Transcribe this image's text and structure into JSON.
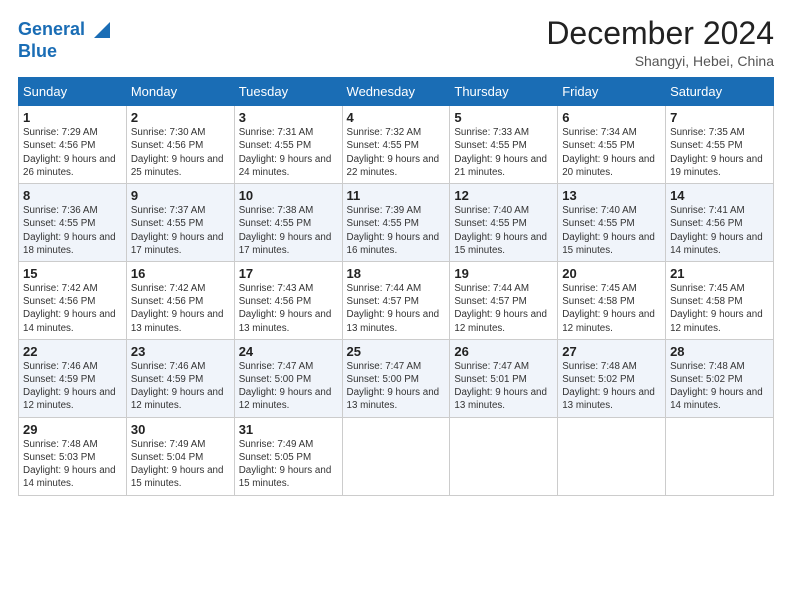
{
  "header": {
    "logo_line1": "General",
    "logo_line2": "Blue",
    "month_title": "December 2024",
    "location": "Shangyi, Hebei, China"
  },
  "weekdays": [
    "Sunday",
    "Monday",
    "Tuesday",
    "Wednesday",
    "Thursday",
    "Friday",
    "Saturday"
  ],
  "weeks": [
    [
      {
        "day": "1",
        "info": "Sunrise: 7:29 AM\nSunset: 4:56 PM\nDaylight: 9 hours and 26 minutes."
      },
      {
        "day": "2",
        "info": "Sunrise: 7:30 AM\nSunset: 4:56 PM\nDaylight: 9 hours and 25 minutes."
      },
      {
        "day": "3",
        "info": "Sunrise: 7:31 AM\nSunset: 4:55 PM\nDaylight: 9 hours and 24 minutes."
      },
      {
        "day": "4",
        "info": "Sunrise: 7:32 AM\nSunset: 4:55 PM\nDaylight: 9 hours and 22 minutes."
      },
      {
        "day": "5",
        "info": "Sunrise: 7:33 AM\nSunset: 4:55 PM\nDaylight: 9 hours and 21 minutes."
      },
      {
        "day": "6",
        "info": "Sunrise: 7:34 AM\nSunset: 4:55 PM\nDaylight: 9 hours and 20 minutes."
      },
      {
        "day": "7",
        "info": "Sunrise: 7:35 AM\nSunset: 4:55 PM\nDaylight: 9 hours and 19 minutes."
      }
    ],
    [
      {
        "day": "8",
        "info": "Sunrise: 7:36 AM\nSunset: 4:55 PM\nDaylight: 9 hours and 18 minutes."
      },
      {
        "day": "9",
        "info": "Sunrise: 7:37 AM\nSunset: 4:55 PM\nDaylight: 9 hours and 17 minutes."
      },
      {
        "day": "10",
        "info": "Sunrise: 7:38 AM\nSunset: 4:55 PM\nDaylight: 9 hours and 17 minutes."
      },
      {
        "day": "11",
        "info": "Sunrise: 7:39 AM\nSunset: 4:55 PM\nDaylight: 9 hours and 16 minutes."
      },
      {
        "day": "12",
        "info": "Sunrise: 7:40 AM\nSunset: 4:55 PM\nDaylight: 9 hours and 15 minutes."
      },
      {
        "day": "13",
        "info": "Sunrise: 7:40 AM\nSunset: 4:55 PM\nDaylight: 9 hours and 15 minutes."
      },
      {
        "day": "14",
        "info": "Sunrise: 7:41 AM\nSunset: 4:56 PM\nDaylight: 9 hours and 14 minutes."
      }
    ],
    [
      {
        "day": "15",
        "info": "Sunrise: 7:42 AM\nSunset: 4:56 PM\nDaylight: 9 hours and 14 minutes."
      },
      {
        "day": "16",
        "info": "Sunrise: 7:42 AM\nSunset: 4:56 PM\nDaylight: 9 hours and 13 minutes."
      },
      {
        "day": "17",
        "info": "Sunrise: 7:43 AM\nSunset: 4:56 PM\nDaylight: 9 hours and 13 minutes."
      },
      {
        "day": "18",
        "info": "Sunrise: 7:44 AM\nSunset: 4:57 PM\nDaylight: 9 hours and 13 minutes."
      },
      {
        "day": "19",
        "info": "Sunrise: 7:44 AM\nSunset: 4:57 PM\nDaylight: 9 hours and 12 minutes."
      },
      {
        "day": "20",
        "info": "Sunrise: 7:45 AM\nSunset: 4:58 PM\nDaylight: 9 hours and 12 minutes."
      },
      {
        "day": "21",
        "info": "Sunrise: 7:45 AM\nSunset: 4:58 PM\nDaylight: 9 hours and 12 minutes."
      }
    ],
    [
      {
        "day": "22",
        "info": "Sunrise: 7:46 AM\nSunset: 4:59 PM\nDaylight: 9 hours and 12 minutes."
      },
      {
        "day": "23",
        "info": "Sunrise: 7:46 AM\nSunset: 4:59 PM\nDaylight: 9 hours and 12 minutes."
      },
      {
        "day": "24",
        "info": "Sunrise: 7:47 AM\nSunset: 5:00 PM\nDaylight: 9 hours and 12 minutes."
      },
      {
        "day": "25",
        "info": "Sunrise: 7:47 AM\nSunset: 5:00 PM\nDaylight: 9 hours and 13 minutes."
      },
      {
        "day": "26",
        "info": "Sunrise: 7:47 AM\nSunset: 5:01 PM\nDaylight: 9 hours and 13 minutes."
      },
      {
        "day": "27",
        "info": "Sunrise: 7:48 AM\nSunset: 5:02 PM\nDaylight: 9 hours and 13 minutes."
      },
      {
        "day": "28",
        "info": "Sunrise: 7:48 AM\nSunset: 5:02 PM\nDaylight: 9 hours and 14 minutes."
      }
    ],
    [
      {
        "day": "29",
        "info": "Sunrise: 7:48 AM\nSunset: 5:03 PM\nDaylight: 9 hours and 14 minutes."
      },
      {
        "day": "30",
        "info": "Sunrise: 7:49 AM\nSunset: 5:04 PM\nDaylight: 9 hours and 15 minutes."
      },
      {
        "day": "31",
        "info": "Sunrise: 7:49 AM\nSunset: 5:05 PM\nDaylight: 9 hours and 15 minutes."
      },
      null,
      null,
      null,
      null
    ]
  ]
}
